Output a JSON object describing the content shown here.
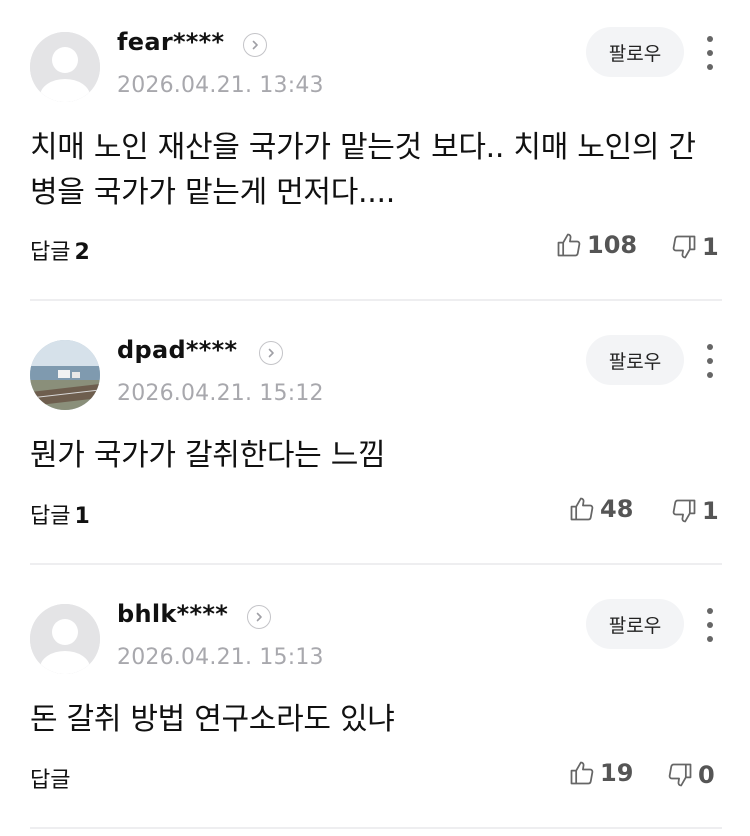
{
  "follow_label": "팔로우",
  "reply_label": "답글",
  "comments": [
    {
      "username": "fear****",
      "timestamp": "2026.04.21. 13:43",
      "body": "치매 노인 재산을 국가가 맡는것 보다.. 치매 노인의 간병을 국가가 맡는게 먼저다....",
      "reply_count": "2",
      "likes": "108",
      "dislikes": "1",
      "avatar": "default-avatar"
    },
    {
      "username": "dpad****",
      "timestamp": "2026.04.21. 15:12",
      "body": "뭔가 국가가 갈취한다는 느낌",
      "reply_count": "1",
      "likes": "48",
      "dislikes": "1",
      "avatar": "landscape-photo-avatar"
    },
    {
      "username": "bhlk****",
      "timestamp": "2026.04.21. 15:13",
      "body": "돈 갈취 방법 연구소라도 있냐",
      "reply_count": "",
      "likes": "19",
      "dislikes": "0",
      "avatar": "default-avatar"
    }
  ],
  "icons": {
    "like": "thumbs-up-icon",
    "dislike": "thumbs-down-icon",
    "profile": "chevron-right-icon",
    "more": "more-vertical-icon"
  }
}
